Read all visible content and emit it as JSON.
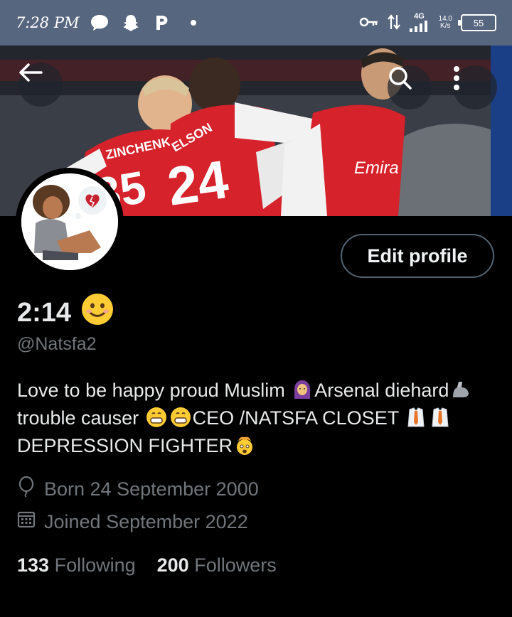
{
  "status_bar": {
    "time": "7:28 PM",
    "icons_left": [
      "chat-icon",
      "snapchat-icon",
      "p-app-icon",
      "dot-icon"
    ],
    "icons_right": [
      "key-icon",
      "data-arrows-icon",
      "signal-icon"
    ],
    "network": "4G",
    "speed": "14.0",
    "speed_unit": "K/s",
    "battery": "55"
  },
  "banner": {
    "jersey_names": [
      "ZINCHENKO",
      "ELSON",
      "Emira"
    ],
    "jersey_numbers": [
      "35",
      "24"
    ]
  },
  "profile": {
    "edit_button": "Edit profile",
    "display_name": "2:14",
    "handle": "@Natsfa2",
    "bio_parts": {
      "p1": "Love to be happy proud Muslim",
      "p2": "Arsenal diehard",
      "p3": "trouble causer",
      "p4": "CEO /NATSFA CLOSET",
      "p5": "DEPRESSION FIGHTER"
    },
    "born": "Born 24 September 2000",
    "joined": "Joined September 2022",
    "following_count": "133",
    "following_label": "Following",
    "followers_count": "200",
    "followers_label": "Followers"
  },
  "colors": {
    "status_bar": "#57667f",
    "background": "#000000",
    "text": "#e7e9ea",
    "muted": "#71767b",
    "button_border": "#536471"
  }
}
